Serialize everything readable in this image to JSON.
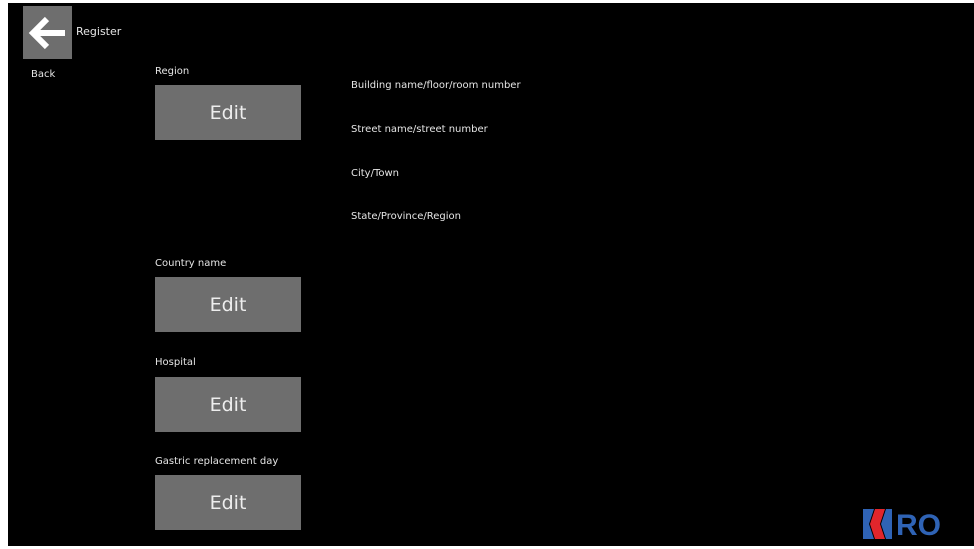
{
  "header": {
    "title": "Register",
    "back_label": "Back",
    "back_icon": "arrow-left-icon"
  },
  "fields": {
    "region": {
      "label": "Region",
      "button": "Edit"
    },
    "country": {
      "label": "Country name",
      "button": "Edit"
    },
    "hospital": {
      "label": "Hospital",
      "button": "Edit"
    },
    "gastric": {
      "label": "Gastric replacement day",
      "button": "Edit"
    }
  },
  "address_lines": [
    "Building name/floor/room number",
    "Street name/street number",
    "City/Town",
    "State/Province/Region"
  ],
  "logo": {
    "text": "RO",
    "icon": "brand-logo-icon"
  },
  "colors": {
    "background": "#000000",
    "button": "#6e6e6e",
    "text": "#e6e6e6",
    "logo_red": "#e1262c",
    "logo_blue": "#2f63b5"
  }
}
